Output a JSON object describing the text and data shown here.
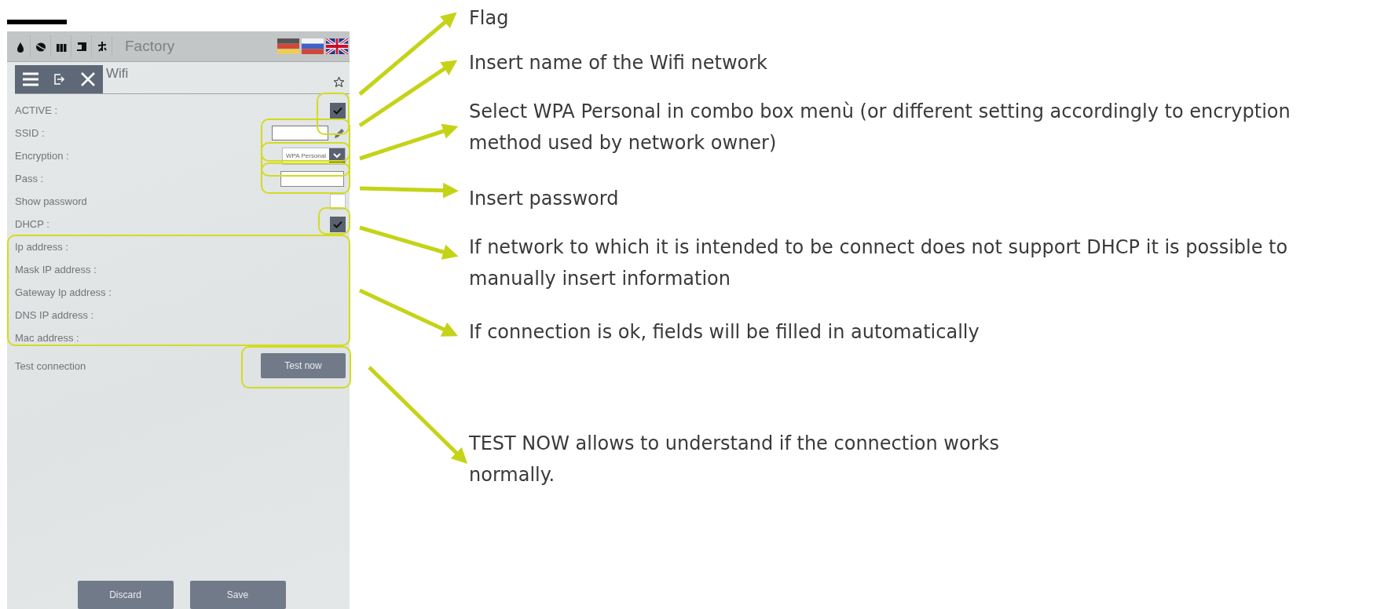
{
  "top_bar": {
    "title": "Factory"
  },
  "header": {
    "title": "Wifi"
  },
  "fields": [
    {
      "kind": "checkbox",
      "label": "ACTIVE :",
      "checked": true
    },
    {
      "kind": "text",
      "label": "SSID :"
    },
    {
      "kind": "select",
      "label": "Encryption :",
      "value": "WPA Personal"
    },
    {
      "kind": "password",
      "label": "Pass :"
    },
    {
      "kind": "checkbox",
      "label": "Show password",
      "checked": false
    },
    {
      "kind": "checkbox",
      "label": "DHCP :",
      "checked": true
    },
    {
      "kind": "info",
      "label": "Ip address :"
    },
    {
      "kind": "info",
      "label": "Mask IP address :"
    },
    {
      "kind": "info",
      "label": "Gateway Ip address :"
    },
    {
      "kind": "info",
      "label": "DNS IP address :"
    },
    {
      "kind": "info",
      "label": "Mac address :"
    },
    {
      "kind": "button",
      "label": "Test connection",
      "button": "Test now"
    }
  ],
  "footer_buttons": [
    "Discard",
    "Save"
  ],
  "annotations": [
    {
      "lines": [
        "Flag"
      ]
    },
    {
      "lines": [
        "Insert name of the Wifi network"
      ]
    },
    {
      "lines": [
        "Select WPA Personal in combo box menù (or different setting accordingly to encryption",
        "method used by network owner)"
      ]
    },
    {
      "lines": [
        "Insert password"
      ]
    },
    {
      "lines": [
        "If network to which it is intended to be connect does not support DHCP it is possible to",
        "manually insert information"
      ]
    },
    {
      "lines": [
        "If connection is ok, fields will be filled in automatically"
      ]
    },
    {
      "lines": [
        "TEST NOW allows to understand if the connection works",
        "normally."
      ]
    }
  ]
}
